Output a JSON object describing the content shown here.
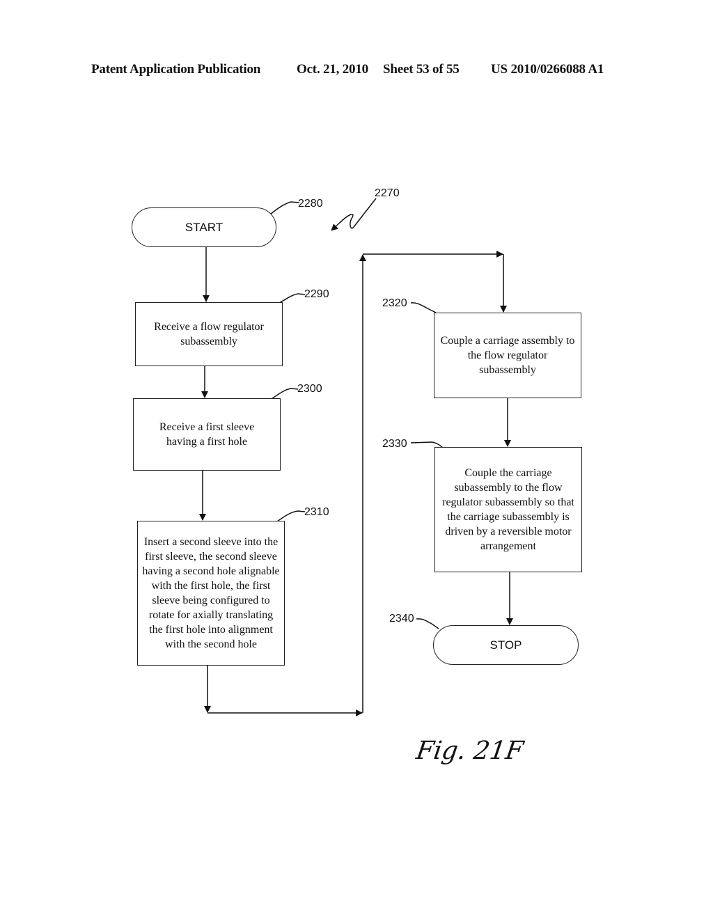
{
  "header": {
    "publication": "Patent Application Publication",
    "date": "Oct. 21, 2010",
    "sheet": "Sheet 53 of 55",
    "number": "US 2010/0266088 A1"
  },
  "diagram": {
    "ref": "2270",
    "steps": [
      {
        "id": "2280",
        "type": "terminal",
        "label": "START"
      },
      {
        "id": "2290",
        "type": "process",
        "label": "Receive a flow regulator subassembly"
      },
      {
        "id": "2300",
        "type": "process",
        "label": "Receive a first sleeve having a first hole"
      },
      {
        "id": "2310",
        "type": "process",
        "label": "Insert a second sleeve into the first sleeve, the second sleeve having a second hole alignable with the first hole, the first sleeve being configured to rotate for axially translating the first hole into alignment with the second hole"
      },
      {
        "id": "2320",
        "type": "process",
        "label": "Couple a carriage assembly to the flow regulator subassembly"
      },
      {
        "id": "2330",
        "type": "process",
        "label": "Couple the carriage subassembly to the flow regulator subassembly so that the carriage subassembly is driven by a reversible motor arrangement"
      },
      {
        "id": "2340",
        "type": "terminal",
        "label": "STOP"
      }
    ]
  },
  "figure_label": "Fig. 21F"
}
